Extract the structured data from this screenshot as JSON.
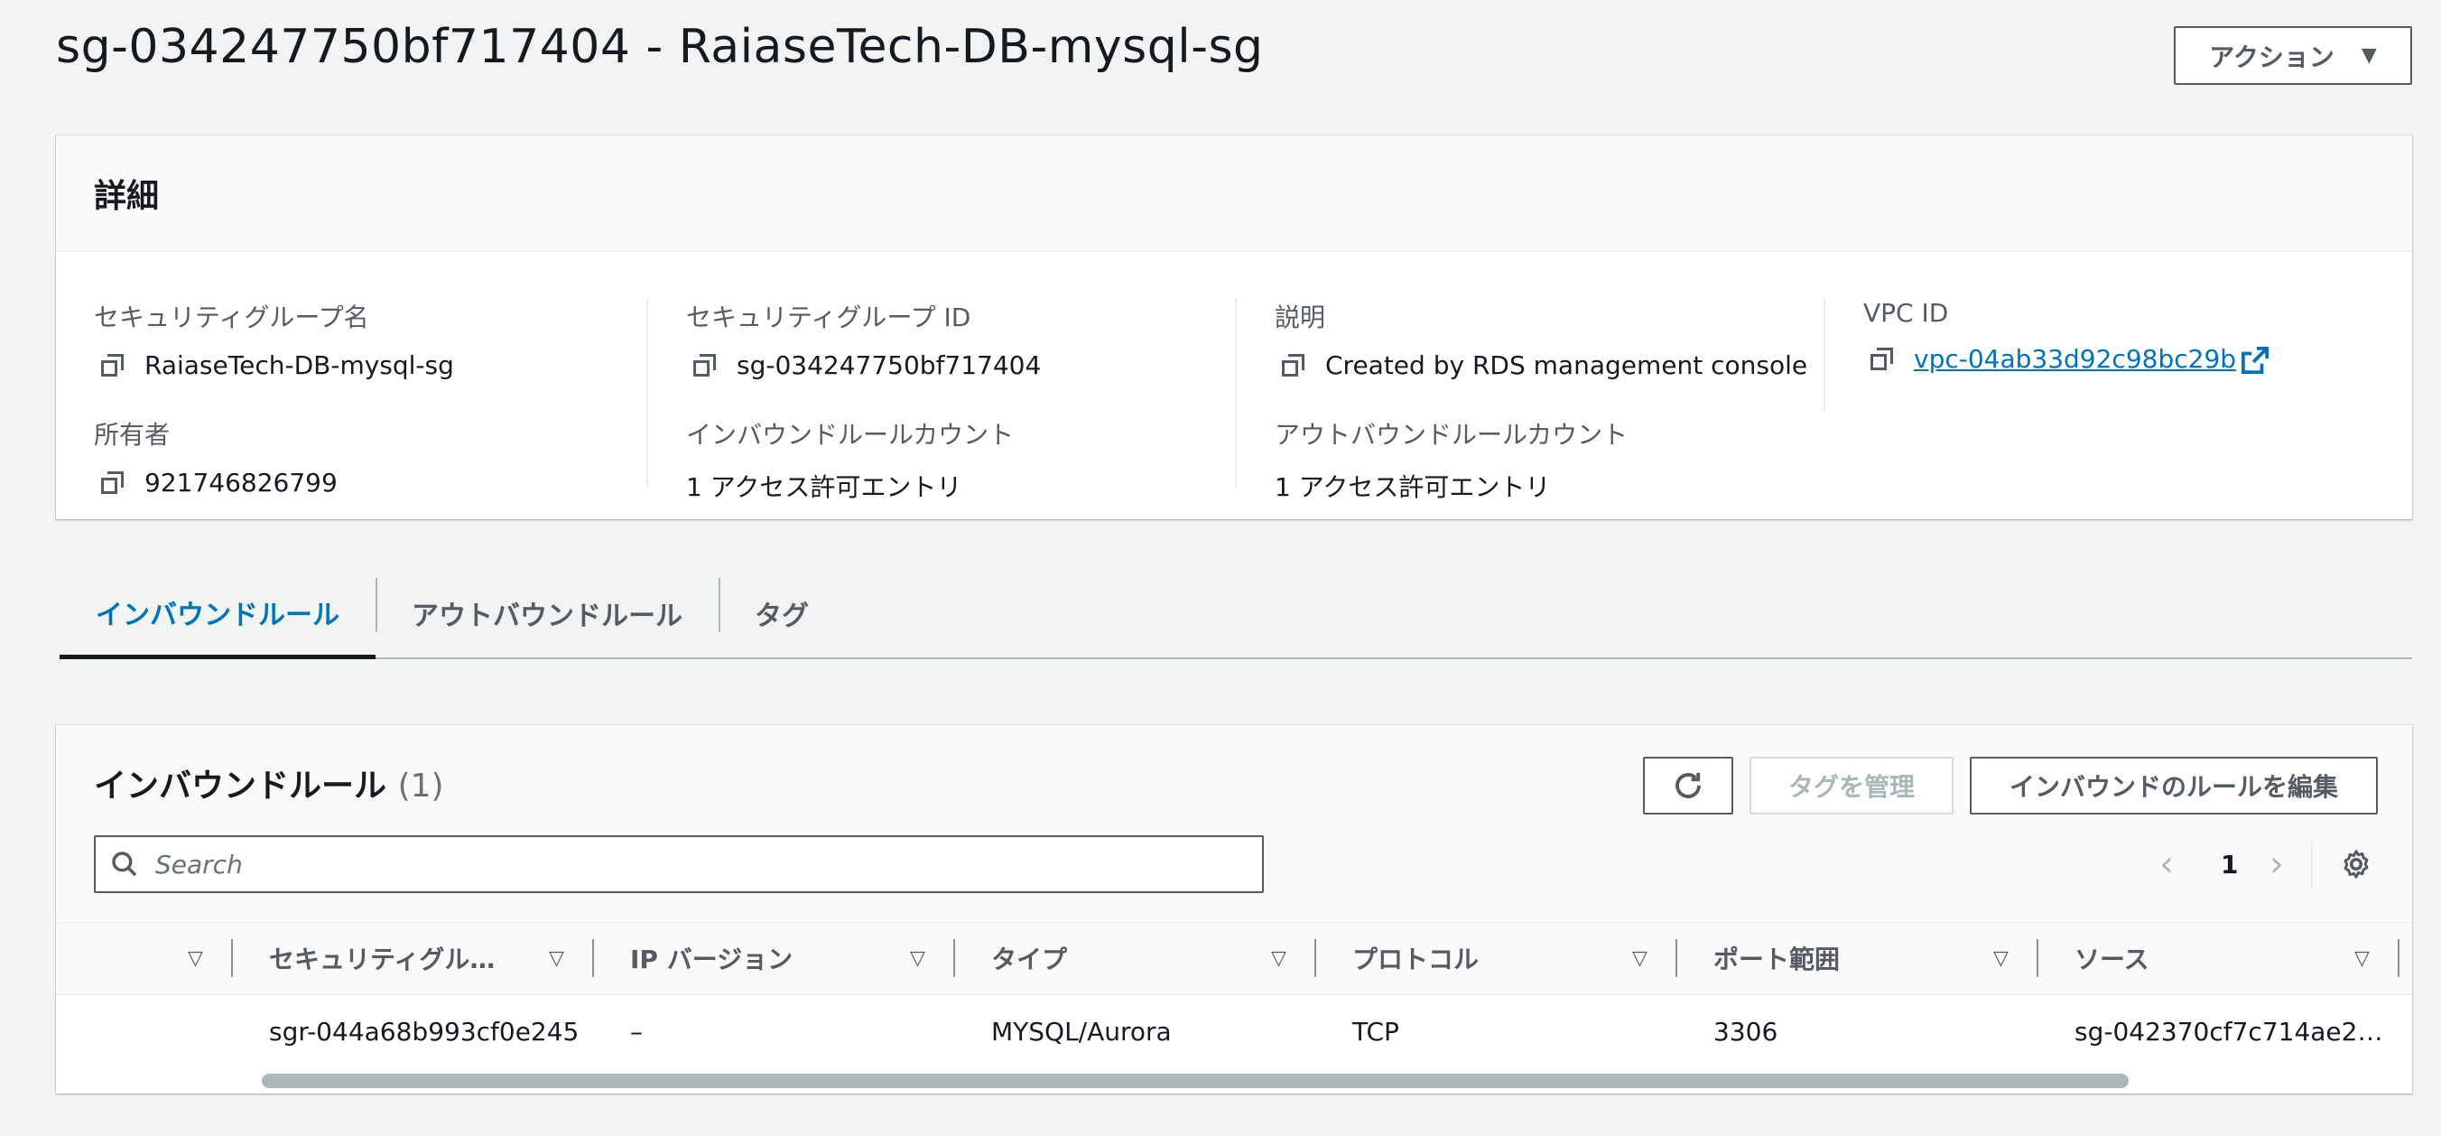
{
  "page": {
    "title": "sg-034247750bf717404 - RaiaseTech-DB-mysql-sg",
    "actions_label": "アクション",
    "actions_caret": "▼"
  },
  "details": {
    "heading": "詳細",
    "sg_name_label": "セキュリティグループ名",
    "sg_name_value": "RaiaseTech-DB-mysql-sg",
    "sg_id_label": "セキュリティグループ ID",
    "sg_id_value": "sg-034247750bf717404",
    "description_label": "説明",
    "description_value": "Created by RDS management console",
    "vpc_label": "VPC ID",
    "vpc_value": "vpc-04ab33d92c98bc29b",
    "owner_label": "所有者",
    "owner_value": "921746826799",
    "inbound_count_label": "インバウンドルールカウント",
    "inbound_count_value": "1 アクセス許可エントリ",
    "outbound_count_label": "アウトバウンドルールカウント",
    "outbound_count_value": "1 アクセス許可エントリ"
  },
  "tabs": [
    {
      "label": "インバウンドルール",
      "active": true
    },
    {
      "label": "アウトバウンドルール",
      "active": false
    },
    {
      "label": "タグ",
      "active": false
    }
  ],
  "rules": {
    "title": "インバウンドルール",
    "count": "(1)",
    "manage_tags_label": "タグを管理",
    "edit_inbound_label": "インバウンドのルールを編集",
    "search_placeholder": "Search",
    "page_number": "1",
    "prev_glyph": "‹",
    "next_glyph": "›",
    "caret_glyph": "▽",
    "columns": [
      "セキュリティグル…",
      "IP バージョン",
      "タイプ",
      "プロトコル",
      "ポート範囲",
      "ソース"
    ],
    "rows": [
      [
        "sgr-044a68b993cf0e245",
        "–",
        "MYSQL/Aurora",
        "TCP",
        "3306",
        "sg-042370cf7c714ae2…"
      ]
    ]
  },
  "icons": {
    "copy": "copy-icon",
    "external_link": "external-link-icon",
    "refresh": "refresh-icon",
    "search": "search-icon",
    "settings": "gear-icon"
  },
  "colors": {
    "link": "#0073bb",
    "text": "#16191f",
    "muted": "#545b64",
    "background": "#f2f3f3"
  }
}
